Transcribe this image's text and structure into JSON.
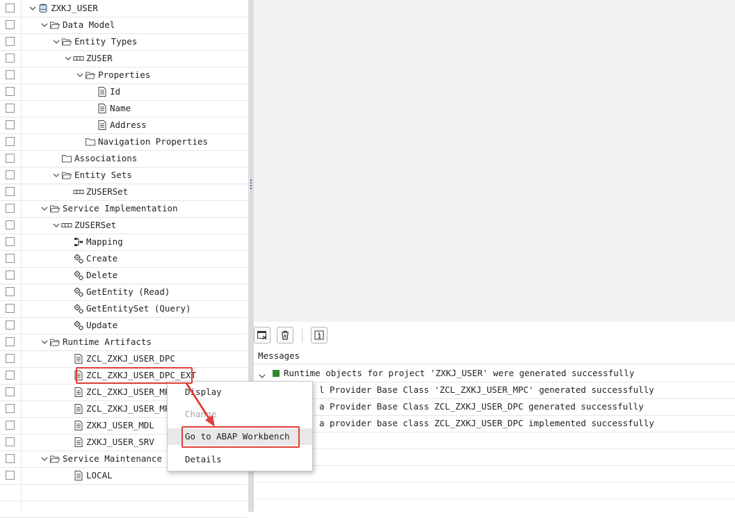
{
  "tree": {
    "nodes": [
      {
        "label": "ZXKJ_USER",
        "icon": "database-icon",
        "expanded": true
      },
      {
        "label": "Data Model",
        "icon": "folder-open-icon",
        "expanded": true
      },
      {
        "label": "Entity Types",
        "icon": "folder-open-icon",
        "expanded": true
      },
      {
        "label": "ZUSER",
        "icon": "entity-icon",
        "expanded": true
      },
      {
        "label": "Properties",
        "icon": "folder-open-icon",
        "expanded": true
      },
      {
        "label": "Id",
        "icon": "property-icon"
      },
      {
        "label": "Name",
        "icon": "property-icon"
      },
      {
        "label": "Address",
        "icon": "property-icon"
      },
      {
        "label": "Navigation Properties",
        "icon": "folder-icon"
      },
      {
        "label": "Associations",
        "icon": "folder-icon"
      },
      {
        "label": "Entity Sets",
        "icon": "folder-open-icon",
        "expanded": true
      },
      {
        "label": "ZUSERSet",
        "icon": "entity-icon"
      },
      {
        "label": "Service Implementation",
        "icon": "folder-open-icon",
        "expanded": true
      },
      {
        "label": "ZUSERSet",
        "icon": "entity-icon",
        "expanded": true
      },
      {
        "label": "Mapping",
        "icon": "mapping-icon"
      },
      {
        "label": "Create",
        "icon": "operation-gear-icon"
      },
      {
        "label": "Delete",
        "icon": "operation-gear-icon"
      },
      {
        "label": "GetEntity (Read)",
        "icon": "operation-gear-icon"
      },
      {
        "label": "GetEntitySet (Query)",
        "icon": "operation-gear-icon"
      },
      {
        "label": "Update",
        "icon": "operation-gear-icon"
      },
      {
        "label": "Runtime Artifacts",
        "icon": "folder-open-icon",
        "expanded": true
      },
      {
        "label": "ZCL_ZXKJ_USER_DPC",
        "icon": "document-icon"
      },
      {
        "label": "ZCL_ZXKJ_USER_DPC_EXT",
        "icon": "document-icon"
      },
      {
        "label": "ZCL_ZXKJ_USER_MPC",
        "icon": "document-icon"
      },
      {
        "label": "ZCL_ZXKJ_USER_MPC_",
        "icon": "document-icon"
      },
      {
        "label": "ZXKJ_USER_MDL",
        "icon": "document-icon"
      },
      {
        "label": "ZXKJ_USER_SRV",
        "icon": "document-icon"
      },
      {
        "label": "Service Maintenance",
        "icon": "folder-open-icon",
        "expanded": true
      },
      {
        "label": "LOCAL",
        "icon": "document-icon"
      }
    ]
  },
  "messages": {
    "header": "Messages",
    "rows": [
      "Runtime objects for project 'ZXKJ_USER' were generated successfully",
      "l Provider Base Class 'ZCL_ZXKJ_USER_MPC' generated successfully",
      "a Provider Base Class ZCL_ZXKJ_USER_DPC generated successfully",
      "a provider base class ZCL_ZXKJ_USER_DPC implemented successfully"
    ]
  },
  "context_menu": {
    "items": [
      "Display",
      "Change",
      "Go to ABAP Workbench",
      "Details"
    ]
  },
  "colors": {
    "highlight": "#e0403a",
    "success": "#2d8a2d"
  }
}
